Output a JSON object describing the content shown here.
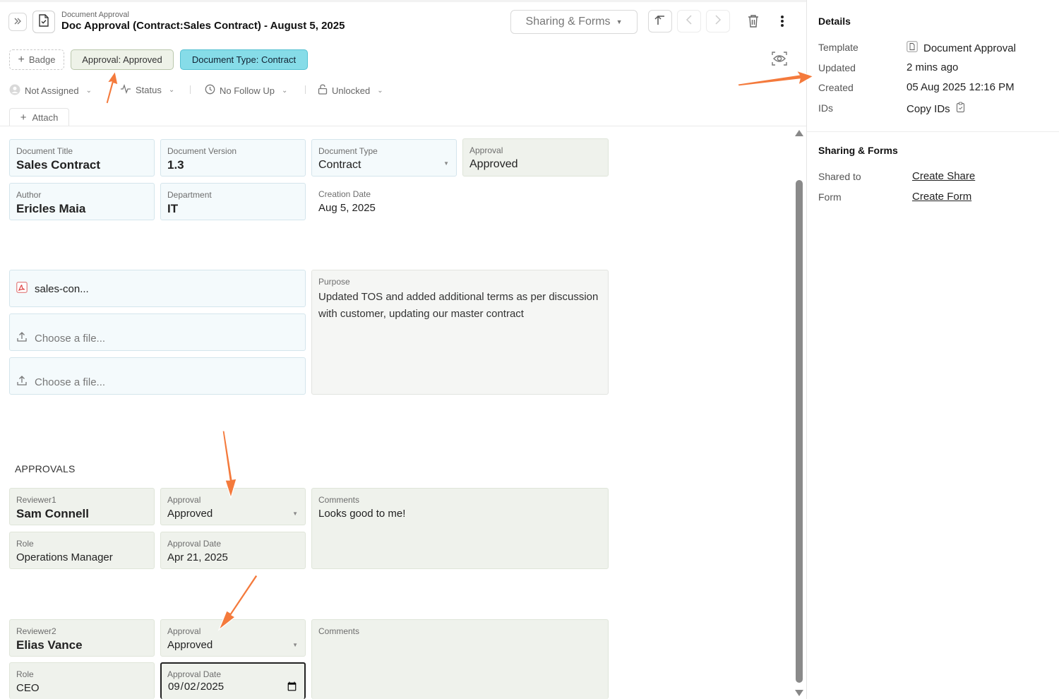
{
  "header": {
    "breadcrumb": "Document Approval",
    "title": "Doc Approval (Contract:Sales Contract) - August 5, 2025",
    "sharing_button": "Sharing & Forms",
    "icons": [
      "chevrons-right-icon",
      "document-check-icon",
      "upload-icon",
      "chevron-left-icon",
      "chevron-right-icon",
      "trash-icon",
      "more-vertical-icon",
      "eye-preview-icon"
    ]
  },
  "badges": {
    "add_label": "Badge",
    "items": [
      "Approval: Approved",
      "Document Type: Contract"
    ]
  },
  "meta": {
    "assignee": "Not Assigned",
    "status": "Status",
    "follow_up": "No Follow Up",
    "lock": "Unlocked",
    "attach": "Attach"
  },
  "fields": {
    "doc_title": {
      "label": "Document Title",
      "value": "Sales Contract"
    },
    "doc_version": {
      "label": "Document Version",
      "value": "1.3"
    },
    "doc_type": {
      "label": "Document Type",
      "value": "Contract"
    },
    "approval": {
      "label": "Approval",
      "value": "Approved"
    },
    "author": {
      "label": "Author",
      "value": "Ericles Maia"
    },
    "department": {
      "label": "Department",
      "value": "IT"
    },
    "creation_date": {
      "label": "Creation Date",
      "value": "Aug 5, 2025"
    },
    "files": [
      {
        "name": "sales-con..."
      },
      {
        "placeholder": "Choose a file..."
      },
      {
        "placeholder": "Choose a file..."
      }
    ],
    "purpose": {
      "label": "Purpose",
      "value": "Updated TOS and added additional terms as per discussion with customer, updating our master contract"
    }
  },
  "approvals": {
    "section_title": "APPROVALS",
    "reviewer1": {
      "reviewer_label": "Reviewer1",
      "reviewer_name": "Sam Connell",
      "approval_label": "Approval",
      "approval_value": "Approved",
      "comments_label": "Comments",
      "comments_value": "Looks good to me!",
      "role_label": "Role",
      "role_value": "Operations Manager",
      "date_label": "Approval Date",
      "date_value": "Apr 21, 2025"
    },
    "reviewer2": {
      "reviewer_label": "Reviewer2",
      "reviewer_name": "Elias Vance",
      "approval_label": "Approval",
      "approval_value": "Approved",
      "comments_label": "Comments",
      "comments_value": "",
      "role_label": "Role",
      "role_value": "CEO",
      "date_label": "Approval Date",
      "date_value": "2025-09-02"
    }
  },
  "details": {
    "title": "Details",
    "template_label": "Template",
    "template_value": "Document Approval",
    "updated_label": "Updated",
    "updated_value": "2 mins ago",
    "created_label": "Created",
    "created_value": "05 Aug 2025 12:16 PM",
    "ids_label": "IDs",
    "ids_value": "Copy IDs"
  },
  "sharing": {
    "title": "Sharing & Forms",
    "shared_label": "Shared to",
    "shared_link": "Create Share",
    "form_label": "Form",
    "form_link": "Create Form"
  },
  "colors": {
    "arrow": "#f47a3c",
    "badge_approval_bg": "#eef2e8",
    "badge_doctype_bg": "#86dce8",
    "field_blue_bg": "#f4fafc",
    "field_green_bg": "#eff2ec"
  }
}
